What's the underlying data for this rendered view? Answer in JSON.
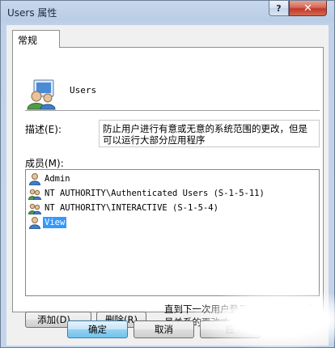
{
  "window": {
    "title": "Users 属性",
    "help_label": "?",
    "close_label": "✕"
  },
  "tabs": [
    {
      "label": "常规",
      "selected": true
    }
  ],
  "general": {
    "group_name": "Users",
    "description_label": "描述(E):",
    "description_value": "防止用户进行有意或无意的系统范围的更改，但是可以运行大部分应用程序",
    "members_label": "成员(M):",
    "members": [
      {
        "name": "Admin",
        "icon": "user-icon",
        "selected": false
      },
      {
        "name": "NT AUTHORITY\\Authenticated Users (S-1-5-11)",
        "icon": "group-icon",
        "selected": false
      },
      {
        "name": "NT AUTHORITY\\INTERACTIVE (S-1-5-4)",
        "icon": "group-icon",
        "selected": false
      },
      {
        "name": "View",
        "icon": "user-icon",
        "selected": true
      }
    ],
    "add_label": "添加(D)...",
    "remove_label": "删除(R)",
    "note": "直到下一次用户登录时对用户的组成员关系的更改才生效。"
  },
  "footer": {
    "ok_label": "确定",
    "cancel_label": "取消",
    "apply_label": "应"
  },
  "colors": {
    "selection": "#3399ff",
    "titlebar": "#bfd2e9",
    "close_button": "#c2392b"
  }
}
